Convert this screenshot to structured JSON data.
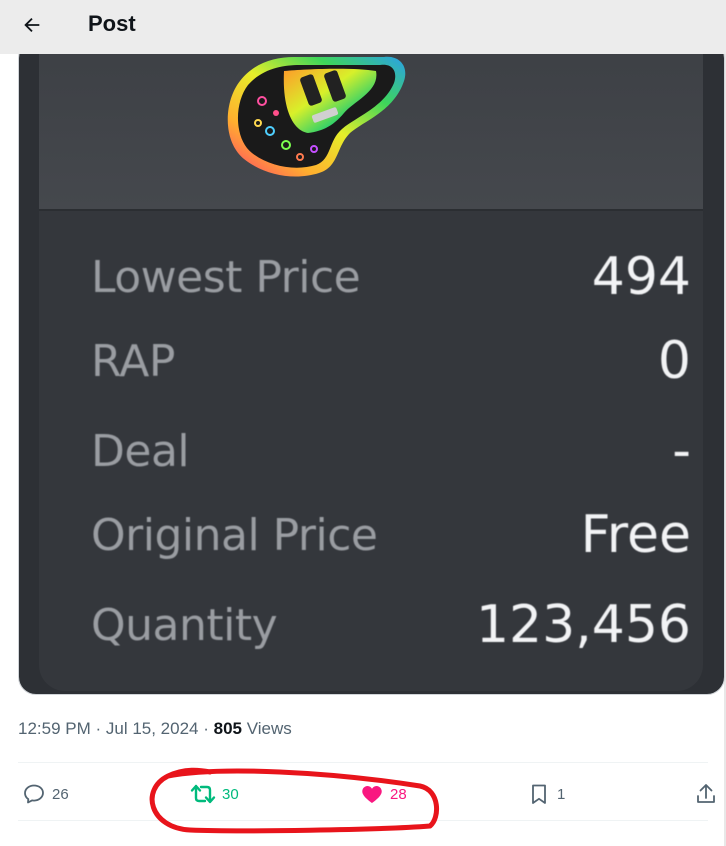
{
  "header": {
    "title": "Post"
  },
  "card": {
    "stats": [
      {
        "label": "Lowest Price",
        "value": "494"
      },
      {
        "label": "RAP",
        "value": "0"
      },
      {
        "label": "Deal",
        "value": "-"
      },
      {
        "label": "Original Price",
        "value": "Free"
      },
      {
        "label": "Quantity",
        "value": "123,456"
      }
    ]
  },
  "meta": {
    "time": "12:59 PM",
    "sep1": " · ",
    "date": "Jul 15, 2024",
    "sep2": " · ",
    "views_count": "805",
    "views_label": " Views"
  },
  "actions": {
    "replies": "26",
    "retweets": "30",
    "likes": "28",
    "bookmarks": "1"
  },
  "colors": {
    "retweet": "#00ba7c",
    "like": "#f91880",
    "annotation": "#e8141b"
  },
  "icons": [
    "back-arrow-icon",
    "reply-icon",
    "retweet-icon",
    "heart-icon",
    "bookmark-icon",
    "share-icon"
  ]
}
